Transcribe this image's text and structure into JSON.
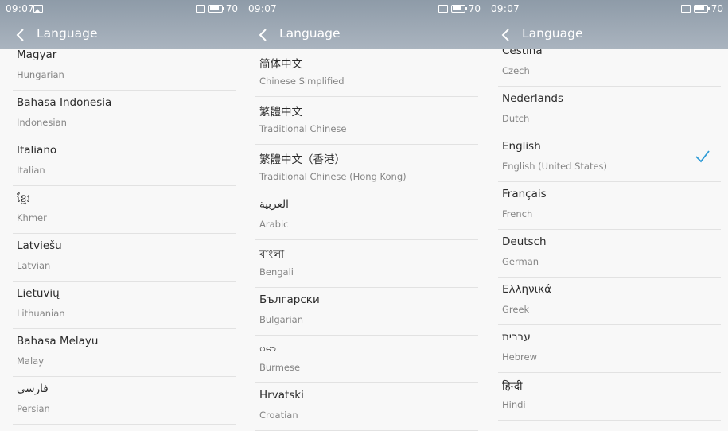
{
  "status": {
    "time": "09:07",
    "battery": "70"
  },
  "title": "Language",
  "colors": {
    "accent": "#2e9bd6",
    "appbar": "#9aa6b2"
  },
  "panels": [
    {
      "items": [
        {
          "native": "Magyar",
          "english": "Hungarian"
        },
        {
          "native": "Bahasa Indonesia",
          "english": "Indonesian"
        },
        {
          "native": "Italiano",
          "english": "Italian"
        },
        {
          "native": "ខ្មែរ",
          "english": "Khmer"
        },
        {
          "native": "Latviešu",
          "english": "Latvian"
        },
        {
          "native": "Lietuvių",
          "english": "Lithuanian"
        },
        {
          "native": "Bahasa Melayu",
          "english": "Malay"
        },
        {
          "native": "فارسی",
          "english": "Persian"
        }
      ]
    },
    {
      "items": [
        {
          "native": "简体中文",
          "english": "Chinese Simplified"
        },
        {
          "native": "繁體中文",
          "english": "Traditional Chinese"
        },
        {
          "native": "繁體中文（香港）",
          "english": "Traditional Chinese (Hong Kong)"
        },
        {
          "native": "العربية",
          "english": "Arabic"
        },
        {
          "native": "বাংলা",
          "english": "Bengali"
        },
        {
          "native": "Български",
          "english": "Bulgarian"
        },
        {
          "native": "ဗမာ",
          "english": "Burmese"
        },
        {
          "native": "Hrvatski",
          "english": "Croatian"
        }
      ]
    },
    {
      "items": [
        {
          "native": "Čeština",
          "english": "Czech"
        },
        {
          "native": "Nederlands",
          "english": "Dutch"
        },
        {
          "native": "English",
          "english": "English (United States)",
          "selected": true
        },
        {
          "native": "Français",
          "english": "French"
        },
        {
          "native": "Deutsch",
          "english": "German"
        },
        {
          "native": "Ελληνικά",
          "english": "Greek"
        },
        {
          "native": "עברית",
          "english": "Hebrew"
        },
        {
          "native": "हिन्दी",
          "english": "Hindi"
        }
      ]
    }
  ]
}
